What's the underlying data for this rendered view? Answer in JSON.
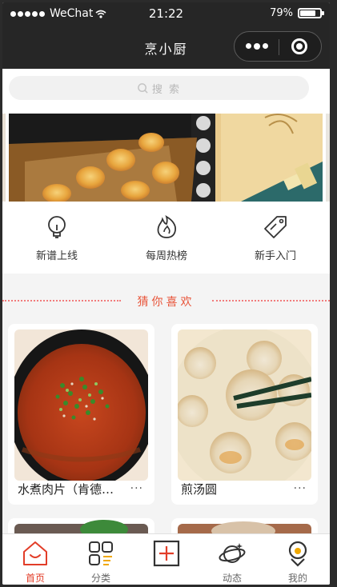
{
  "status_bar": {
    "carrier": "WeChat",
    "time": "21:22",
    "battery": "79%"
  },
  "nav": {
    "title": "烹小厨"
  },
  "search": {
    "placeholder": "搜 索"
  },
  "quick_nav": [
    {
      "label": "新谱上线",
      "icon": "bulb-icon"
    },
    {
      "label": "每周热榜",
      "icon": "flame-icon"
    },
    {
      "label": "新手入门",
      "icon": "tag-icon"
    }
  ],
  "section": {
    "title": "猜你喜欢"
  },
  "recipes": [
    {
      "name": "水煮肉片（肯德基版）",
      "more": "···"
    },
    {
      "name": "煎汤圆",
      "more": "···"
    }
  ],
  "tabs": [
    {
      "label": "首页",
      "icon": "home-icon",
      "active": true
    },
    {
      "label": "分类",
      "icon": "category-icon",
      "active": false
    },
    {
      "label": "",
      "icon": "add-icon",
      "active": false
    },
    {
      "label": "动态",
      "icon": "planet-icon",
      "active": false
    },
    {
      "label": "我的",
      "icon": "profile-icon",
      "active": false
    }
  ],
  "colors": {
    "accent": "#e23d28",
    "section_accent": "#e8553a",
    "dark_bar": "#262626"
  }
}
